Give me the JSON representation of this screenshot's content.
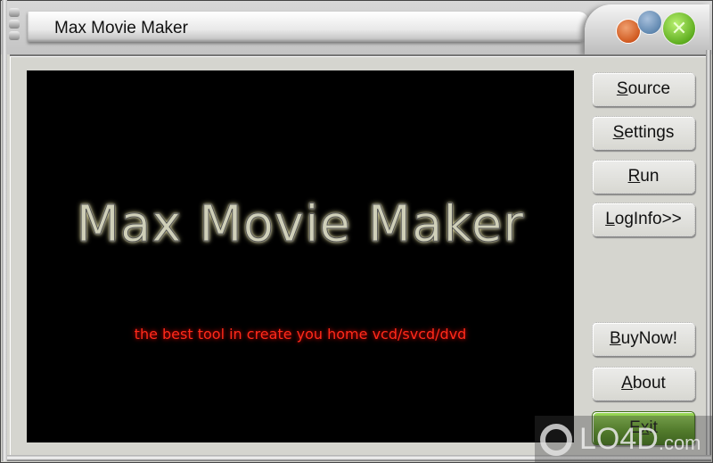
{
  "window": {
    "title": "Max Movie Maker",
    "controls": {
      "minimize": "orange-orb-icon",
      "maximize": "blue-orb-icon",
      "close": "close-x-icon",
      "close_glyph": "✕"
    }
  },
  "preview": {
    "logo_text": "Max Movie Maker",
    "tagline": "the best tool in create you home vcd/svcd/dvd"
  },
  "buttons": [
    {
      "mnemonic": "S",
      "rest": "ource",
      "label": "Source"
    },
    {
      "mnemonic": "S",
      "rest": "ettings",
      "label": "Settings"
    },
    {
      "mnemonic": "R",
      "rest": "un",
      "label": "Run"
    },
    {
      "mnemonic": "L",
      "rest": "ogInfo>>",
      "label": "LogInfo>>"
    },
    {
      "mnemonic": "B",
      "rest": "uyNow!",
      "label": "BuyNow!"
    },
    {
      "mnemonic": "A",
      "rest": "bout",
      "label": "About"
    },
    {
      "pre": "E",
      "mnemonic": "x",
      "rest": "it",
      "label": "Exit"
    }
  ],
  "watermark": {
    "brand": "LO4D",
    "suffix": ".com"
  }
}
